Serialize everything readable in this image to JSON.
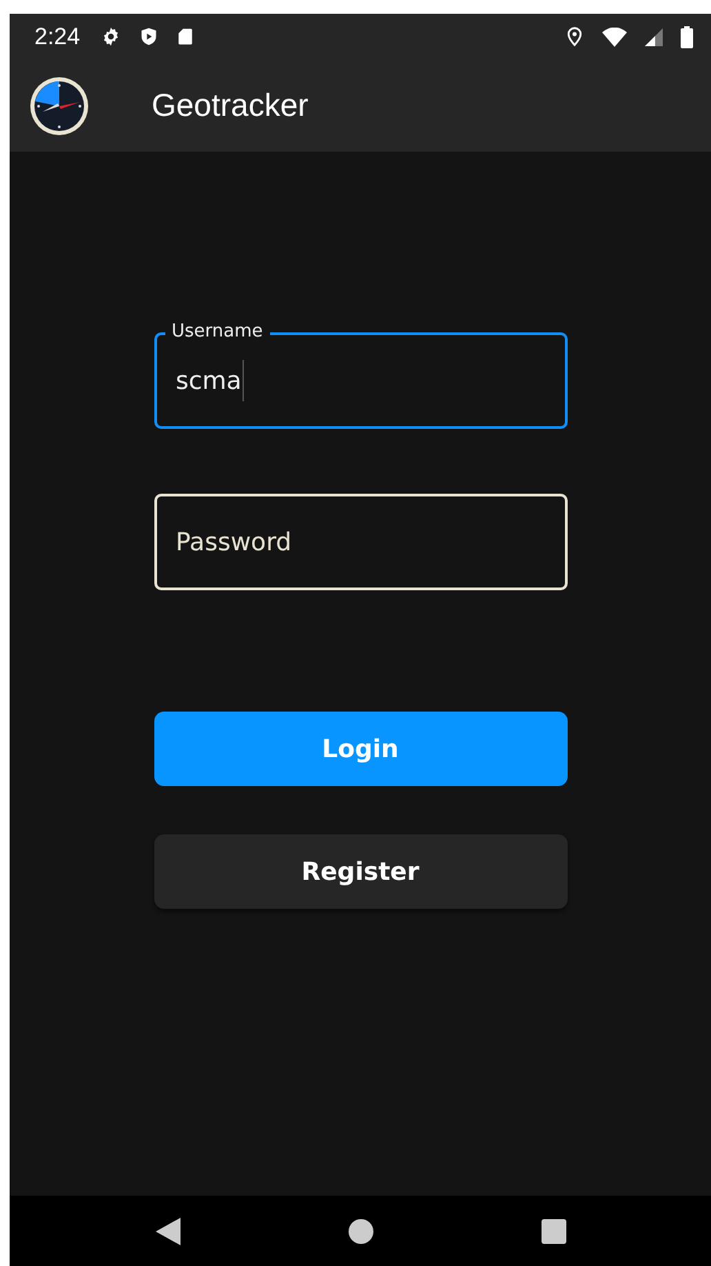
{
  "status_bar": {
    "time": "2:24"
  },
  "app_bar": {
    "title": "Geotracker"
  },
  "fields": [
    {
      "label": "Username",
      "value": "scma",
      "focused": true
    },
    {
      "placeholder": "Password",
      "focused": false
    }
  ],
  "buttons": [
    {
      "label": "Login",
      "kind": "primary"
    },
    {
      "label": "Register",
      "kind": "secondary"
    }
  ]
}
